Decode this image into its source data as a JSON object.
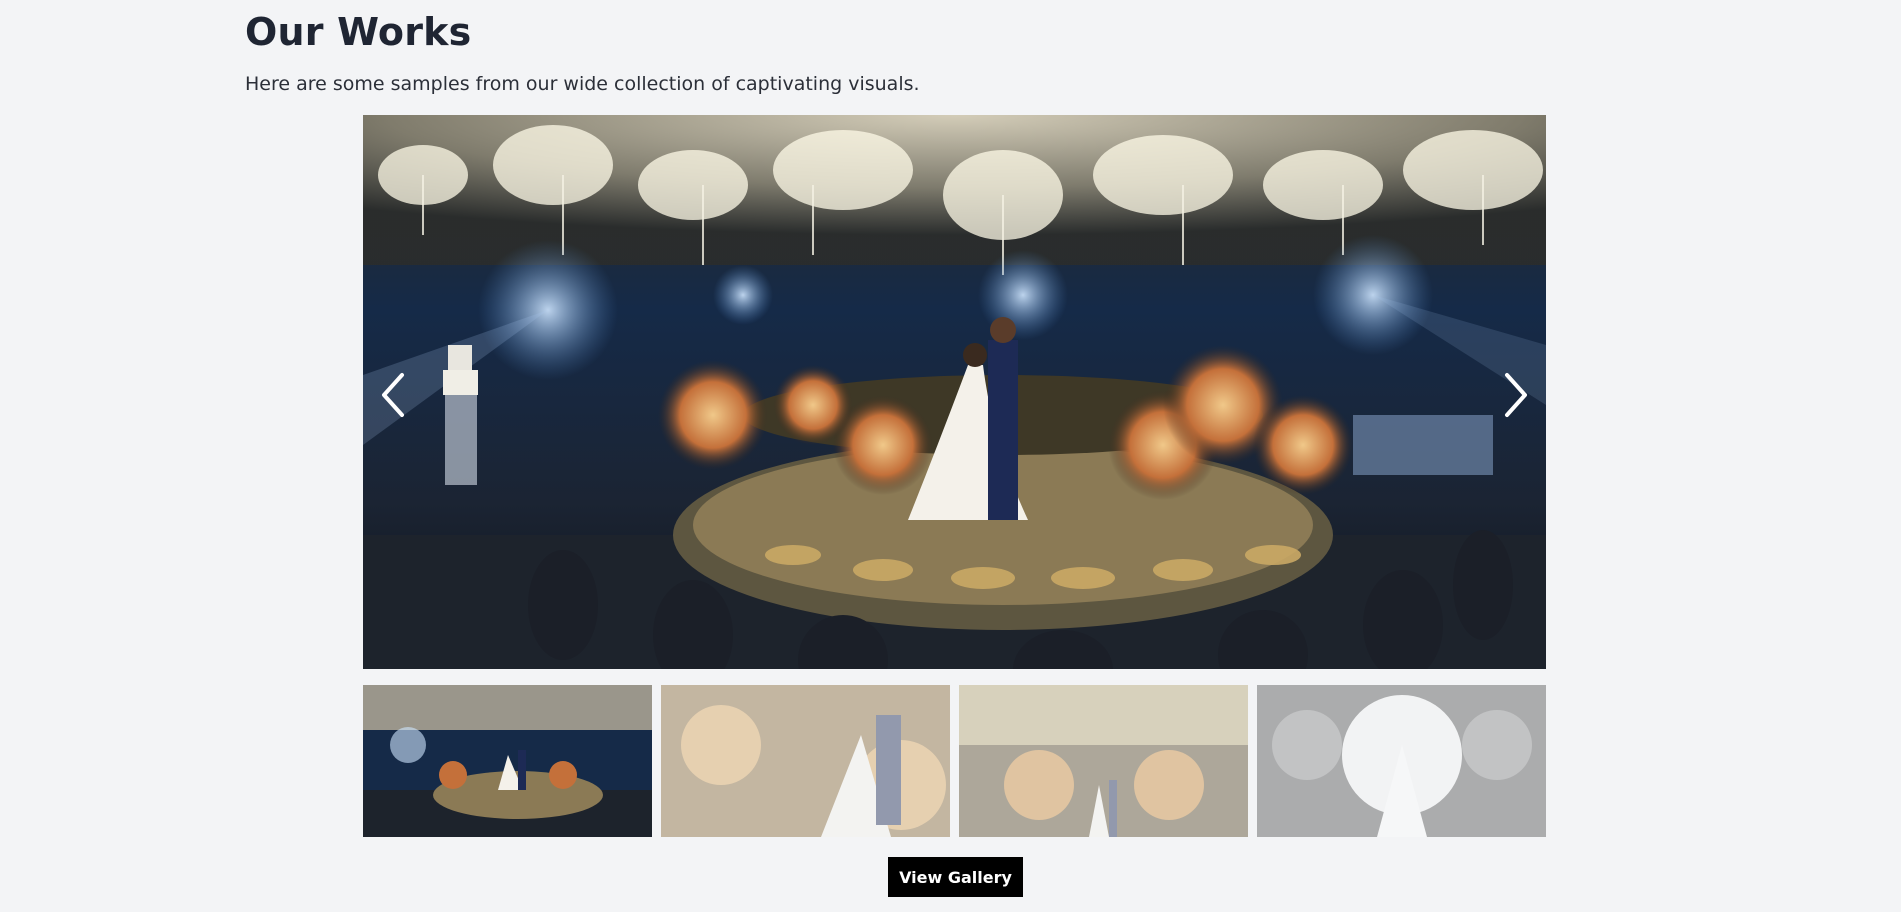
{
  "section": {
    "title": "Our Works",
    "subtitle": "Here are some samples from our wide collection of captivating visuals."
  },
  "slider": {
    "prev_icon": "chevron-left-icon",
    "next_icon": "chevron-right-icon",
    "active_index": 0,
    "thumbnail_count": 4
  },
  "actions": {
    "view_gallery_label": "View Gallery"
  },
  "colors": {
    "background": "#f3f4f6",
    "title": "#1f2533",
    "button_bg": "#000000",
    "button_text": "#ffffff"
  }
}
